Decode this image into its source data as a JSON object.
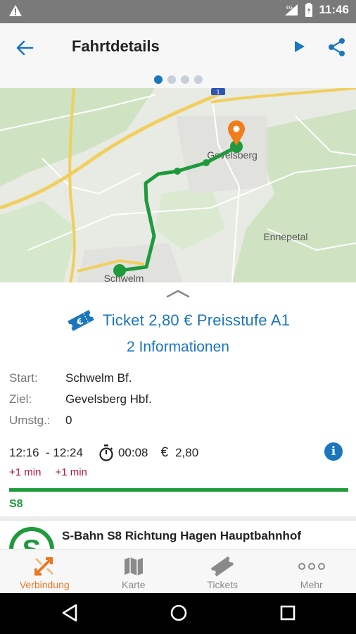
{
  "status_bar": {
    "network": "4G",
    "time": "11:46"
  },
  "app_bar": {
    "title": "Fahrtdetails"
  },
  "pager": {
    "count": 4,
    "active_index": 0
  },
  "map": {
    "labels": {
      "gevelsberg": "Gevelsberg",
      "ennepetal": "Ennepetal",
      "schwelm": "Schwelm",
      "highway_shield": "1"
    }
  },
  "trip": {
    "ticket_label": "Ticket 2,80 € Preisstufe A1",
    "info_label": "2 Informationen",
    "start_label": "Start:",
    "start_value": "Schwelm Bf.",
    "ziel_label": "Ziel:",
    "ziel_value": "Gevelsberg Hbf.",
    "umstg_label": "Umstg.:",
    "umstg_value": "0",
    "dep_time": "12:16",
    "arr_time": "12:24",
    "duration": "00:08",
    "price_symbol": "€",
    "price": "2,80",
    "dep_delay": "+1 min",
    "arr_delay": "+1 min",
    "line": "S8",
    "line_color": "#1e9a3c",
    "service_title": "S-Bahn S8 Richtung Hagen Hauptbahnhof"
  },
  "bottom_nav": {
    "items": [
      {
        "label": "Verbindung",
        "icon": "route-icon",
        "active": true
      },
      {
        "label": "Karte",
        "icon": "map-icon",
        "active": false
      },
      {
        "label": "Tickets",
        "icon": "ticket-icon",
        "active": false
      },
      {
        "label": "Mehr",
        "icon": "more-icon",
        "active": false
      }
    ]
  },
  "colors": {
    "primary": "#1a76bd",
    "accent": "#e87722",
    "delay": "#b0183a"
  }
}
